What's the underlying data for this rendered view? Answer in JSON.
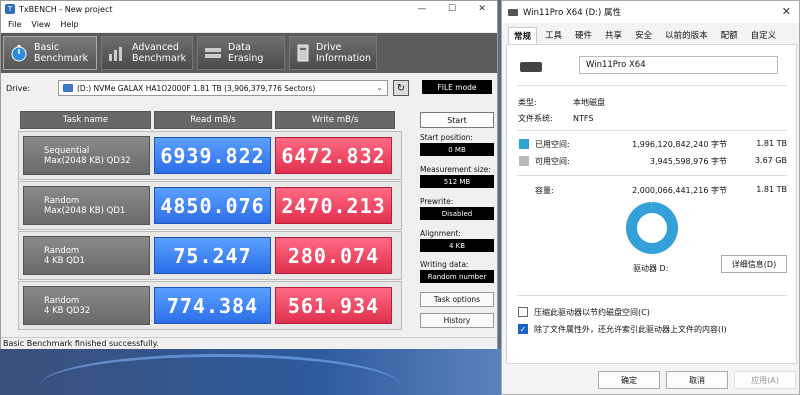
{
  "tx": {
    "title": "TxBENCH - New project",
    "menu": [
      "File",
      "View",
      "Help"
    ],
    "tabs": [
      {
        "line1": "Basic",
        "line2": "Benchmark",
        "icon": "stopwatch-icon"
      },
      {
        "line1": "Advanced",
        "line2": "Benchmark",
        "icon": "bar-chart-icon"
      },
      {
        "line1": "Data Erasing",
        "line2": "",
        "icon": "eraser-icon"
      },
      {
        "line1": "Drive",
        "line2": "Information",
        "icon": "drive-info-icon"
      }
    ],
    "drive_label": "Drive:",
    "drive_value": "(D:) NVMe GALAX HA1O2000F  1.81 TB (3,906,379,776 Sectors)",
    "file_mode": "FILE mode",
    "headers": {
      "task": "Task name",
      "read": "Read mB/s",
      "write": "Write mB/s"
    },
    "rows": [
      {
        "l1": "Sequential",
        "l2": "Max(2048 KB) QD32",
        "read": "6939.822",
        "write": "6472.832"
      },
      {
        "l1": "Random",
        "l2": "Max(2048 KB) QD1",
        "read": "4850.076",
        "write": "2470.213"
      },
      {
        "l1": "Random",
        "l2": "4 KB QD1",
        "read": "75.247",
        "write": "280.074"
      },
      {
        "l1": "Random",
        "l2": "4 KB QD32",
        "read": "774.384",
        "write": "561.934"
      }
    ],
    "side": {
      "start": "Start",
      "start_pos_label": "Start position:",
      "start_pos": "0 MB",
      "meas_label": "Measurement size:",
      "meas": "512 MB",
      "prewrite_label": "Prewrite:",
      "prewrite": "Disabled",
      "align_label": "Alignment:",
      "align": "4 KB",
      "writing_label": "Writing data:",
      "writing": "Random number",
      "task_options": "Task options",
      "history": "History"
    },
    "status": "Basic Benchmark finished successfully.",
    "colors": {
      "read": "#2d6ee8",
      "write": "#e0304f"
    }
  },
  "props": {
    "title": "Win11Pro X64 (D:) 属性",
    "tabs": [
      "常规",
      "工具",
      "硬件",
      "共享",
      "安全",
      "以前的版本",
      "配额",
      "自定义"
    ],
    "name": "Win11Pro X64",
    "type_label": "类型:",
    "type": "本地磁盘",
    "fs_label": "文件系统:",
    "fs": "NTFS",
    "used_label": "已用空间:",
    "used_bytes": "1,996,120,842,240 字节",
    "used_size": "1.81 TB",
    "free_label": "可用空间:",
    "free_bytes": "3,945,598,976 字节",
    "free_size": "3.67 GB",
    "cap_label": "容量:",
    "cap_bytes": "2,000,066,441,216 字节",
    "cap_size": "1.81 TB",
    "used_fraction": 0.998,
    "drive_label": "驱动器 D:",
    "details": "详细信息(D)",
    "compress": "压缩此驱动器以节约磁盘空间(C)",
    "index": "除了文件属性外，还允许索引此驱动器上文件的内容(I)",
    "compress_checked": false,
    "index_checked": true,
    "ok": "确定",
    "cancel": "取消",
    "apply": "应用(A)",
    "colors": {
      "used": "#34a0d8",
      "free": "#b9b9b9"
    }
  }
}
